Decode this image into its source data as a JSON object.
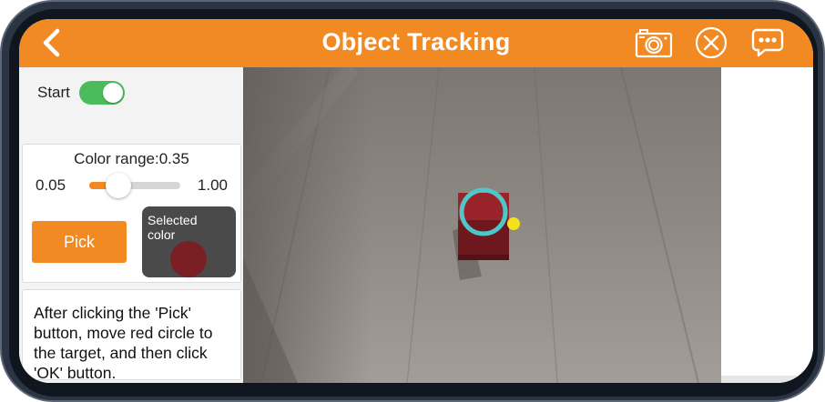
{
  "header": {
    "title": "Object Tracking",
    "background": "#f28a23"
  },
  "controls": {
    "start_label": "Start",
    "start_on": true,
    "color_range_label": "Color range:0.35",
    "range_min": "0.05",
    "range_max": "1.00",
    "range_value": 0.35,
    "pick_label": "Pick",
    "selected_color_label": "Selected color",
    "selected_color": "#7a1f24"
  },
  "instructions": {
    "text": "After clicking the 'Pick' button, move red circle to the target, and then click 'OK' button."
  },
  "camera": {
    "tracking_ring_color": "#4fc6c8",
    "marker_color": "#f3e11a",
    "object_color": "#8f1f25"
  },
  "icons": {
    "back": "chevron-left-icon",
    "camera": "camera-icon",
    "close": "close-circle-icon",
    "chat": "chat-bubble-icon"
  }
}
